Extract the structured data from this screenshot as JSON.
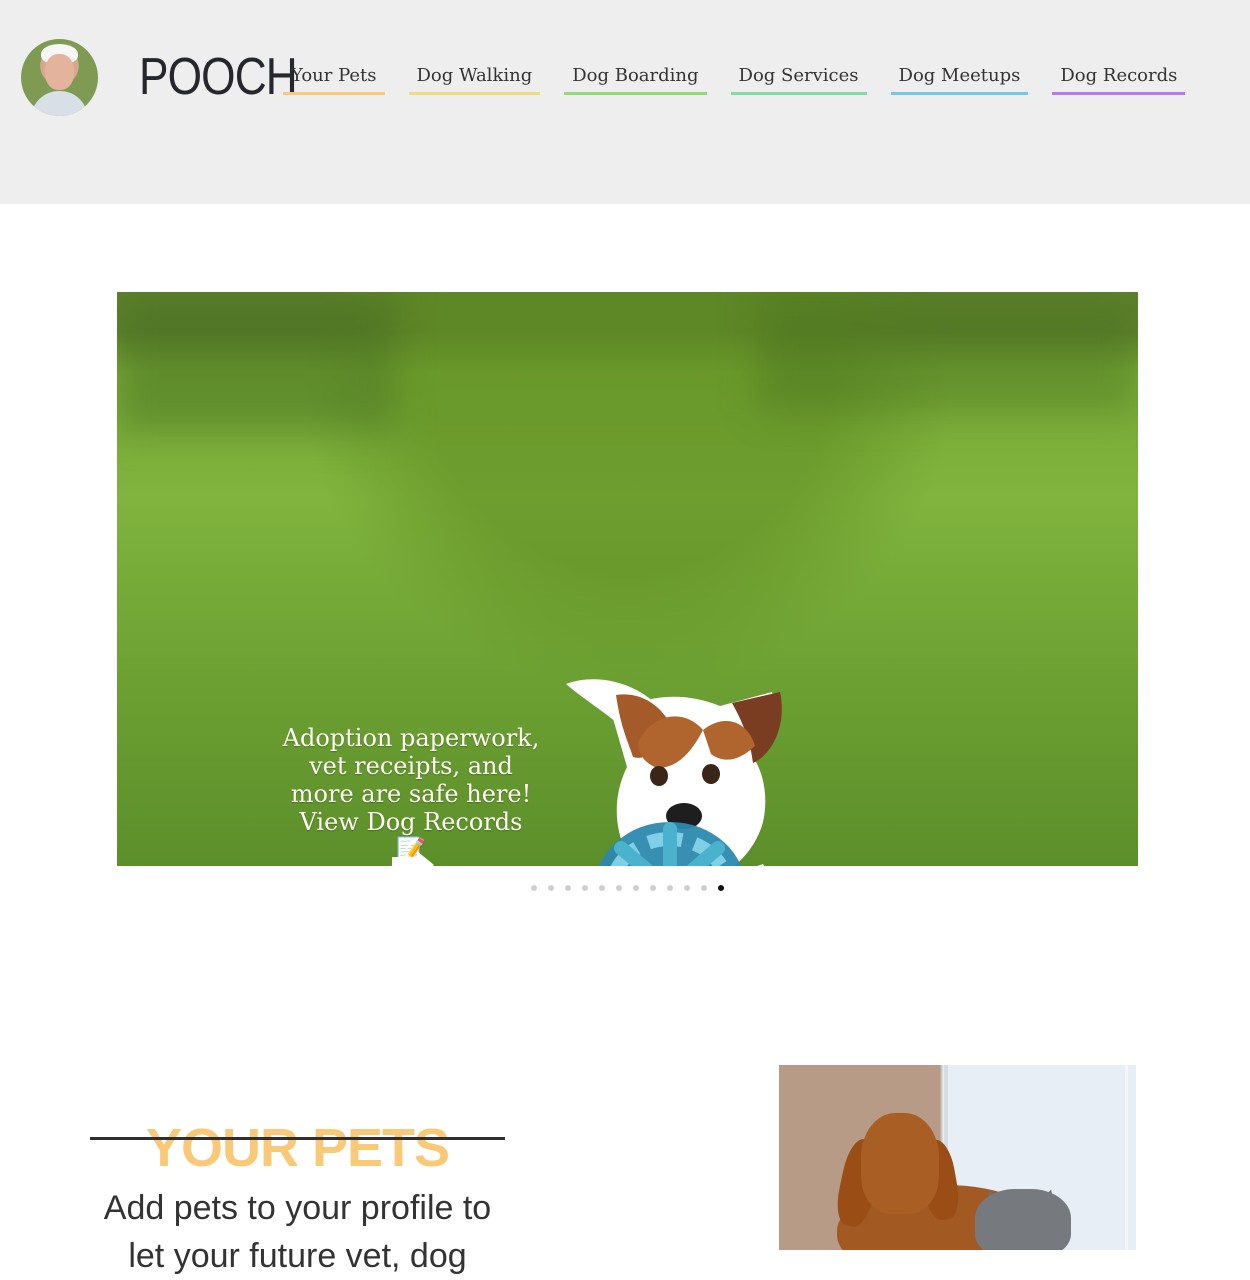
{
  "header": {
    "logo": "POOCH",
    "avatar": "user-avatar",
    "nav": [
      {
        "label": "Your Pets",
        "color": "#f9c978"
      },
      {
        "label": "Dog Walking",
        "color": "#f3da7d"
      },
      {
        "label": "Dog Boarding",
        "color": "#90dc79"
      },
      {
        "label": "Dog Services",
        "color": "#7ddfa1"
      },
      {
        "label": "Dog Meetups",
        "color": "#72c7ed"
      },
      {
        "label": "Dog Records",
        "color": "#b978f2"
      }
    ]
  },
  "slider": {
    "caption": "Adoption paperwork, vet receipts, and more are safe here! View Dog Records 📝",
    "arrow": "right-arrow-icon",
    "image": "dog-running-with-ball",
    "dot_count": 12,
    "active_dot": 12
  },
  "pets_section": {
    "title": "YOUR PETS",
    "description": "Add pets to your profile to let your future vet, dog",
    "image": "dog-and-cat"
  },
  "colors": {
    "header_background": "#eeeeee",
    "title_accent": "#f9c978"
  }
}
